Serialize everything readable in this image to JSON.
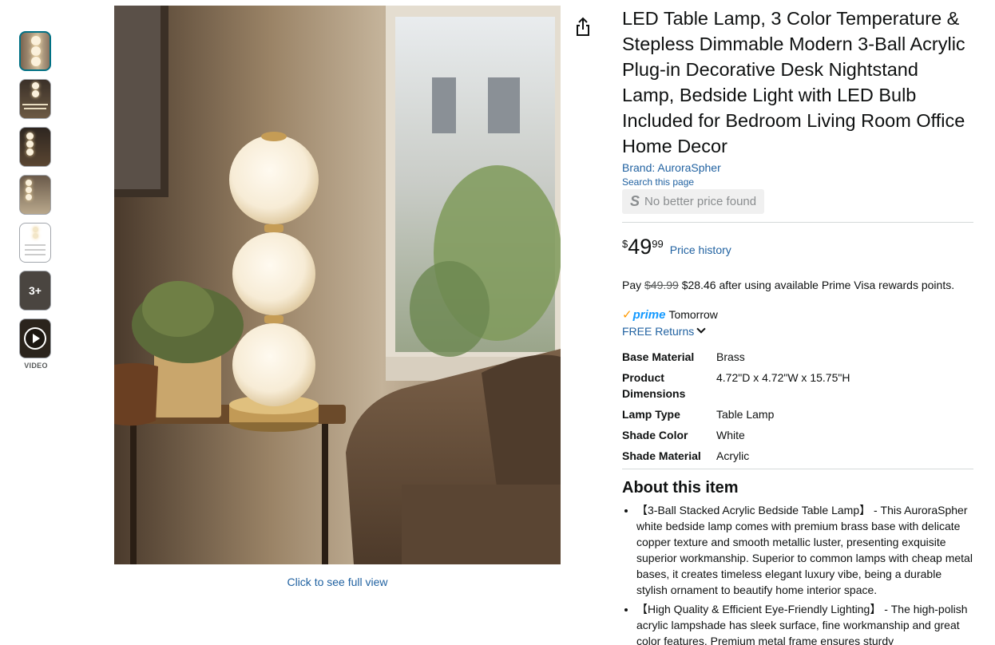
{
  "thumbnails": {
    "more_label": "3+",
    "video_label": "VIDEO"
  },
  "main": {
    "full_view_link": "Click to see full view"
  },
  "product": {
    "title": "LED Table Lamp, 3 Color Temperature & Stepless Dimmable Modern 3-Ball Acrylic Plug-in Decorative Desk Nightstand Lamp, Bedside Light with LED Bulb Included for Bedroom Living Room Office Home Decor",
    "brand": "Brand: AuroraSpher",
    "search_page": "Search this page",
    "no_better_price": "No better price found",
    "price_symbol": "$",
    "price_whole": "49",
    "price_fraction": "99",
    "price_history": "Price history",
    "pay_prefix": "Pay",
    "pay_old": "$49.99",
    "pay_rest": "$28.46 after using available Prime Visa rewards points.",
    "prime_word": "prime",
    "prime_delivery": "Tomorrow",
    "free_returns": "FREE Returns",
    "specs": [
      {
        "key": "Base Material",
        "value": "Brass"
      },
      {
        "key": "Product Dimensions",
        "value": "4.72\"D x 4.72\"W x 15.75\"H"
      },
      {
        "key": "Lamp Type",
        "value": "Table Lamp"
      },
      {
        "key": "Shade Color",
        "value": "White"
      },
      {
        "key": "Shade Material",
        "value": "Acrylic"
      }
    ],
    "about_heading": "About this item",
    "bullets": [
      "【3-Ball Stacked Acrylic Bedside Table Lamp】 - This AuroraSpher white bedside lamp comes with premium brass base with delicate copper texture and smooth metallic luster, presenting exquisite superior workmanship. Superior to common lamps with cheap metal bases, it creates timeless elegant luxury vibe, being a durable stylish ornament to beautify home interior space.",
      "【High Quality & Efficient Eye-Friendly Lighting】 - The high-polish acrylic lampshade has sleek surface, fine workmanship and great color features. Premium metal frame ensures sturdy"
    ]
  },
  "colors": {
    "link": "#2162a1",
    "prime_blue": "#1399ff",
    "prime_orange": "#ff9900",
    "active_thumb_border": "#007185"
  }
}
